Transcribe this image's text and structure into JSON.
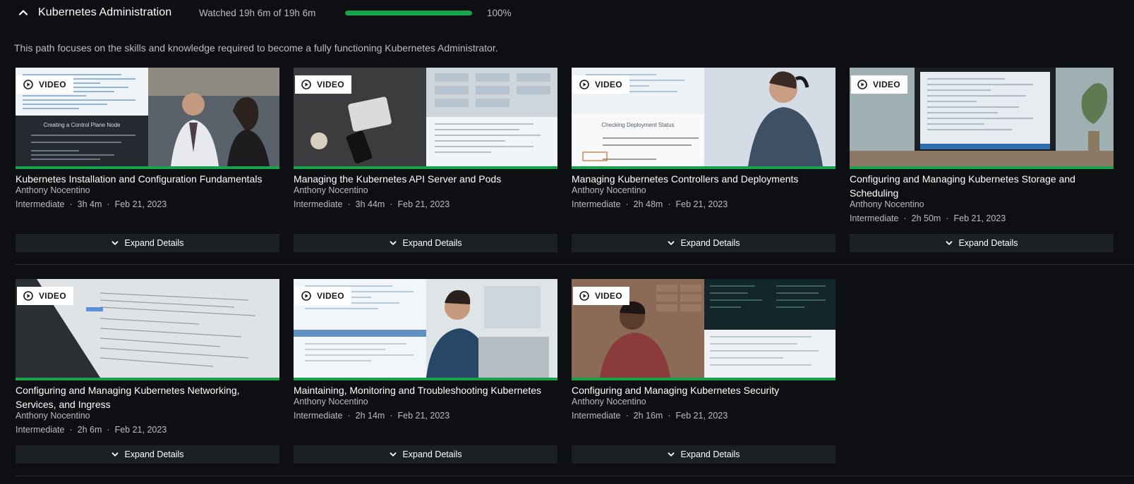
{
  "path": {
    "title": "Kubernetes Administration",
    "watched": "Watched 19h 6m of 19h 6m",
    "progress_fraction": 1.0,
    "progress_label": "100%",
    "description": "This path focuses on the skills and knowledge required to become a fully functioning Kubernetes Administrator.",
    "accent_color": "#17a34a"
  },
  "icons": {
    "collapse": "chevron-up-icon",
    "play": "play-circle-icon",
    "expand": "chevron-down-icon"
  },
  "courses": [
    {
      "badge": "VIDEO",
      "title": "Kubernetes Installation and Configuration Fundamentals",
      "author": "Anthony Nocentino",
      "level": "Intermediate",
      "duration": "3h 4m",
      "date": "Feb 21, 2023",
      "expand_label": "Expand Details",
      "thumb_text": "Creating a Control Plane Node"
    },
    {
      "badge": "VIDEO",
      "title": "Managing the Kubernetes API Server and Pods",
      "author": "Anthony Nocentino",
      "level": "Intermediate",
      "duration": "3h 44m",
      "date": "Feb 21, 2023",
      "expand_label": "Expand Details"
    },
    {
      "badge": "VIDEO",
      "title": "Managing Kubernetes Controllers and Deployments",
      "author": "Anthony Nocentino",
      "level": "Intermediate",
      "duration": "2h 48m",
      "date": "Feb 21, 2023",
      "expand_label": "Expand Details",
      "thumb_text": "Checking Deployment Status"
    },
    {
      "badge": "VIDEO",
      "title": "Configuring and Managing Kubernetes Storage and Scheduling",
      "author": "Anthony Nocentino",
      "level": "Intermediate",
      "duration": "2h 50m",
      "date": "Feb 21, 2023",
      "expand_label": "Expand Details"
    },
    {
      "badge": "VIDEO",
      "title": "Configuring and Managing Kubernetes Networking, Services, and Ingress",
      "author": "Anthony Nocentino",
      "level": "Intermediate",
      "duration": "2h 6m",
      "date": "Feb 21, 2023",
      "expand_label": "Expand Details"
    },
    {
      "badge": "VIDEO",
      "title": "Maintaining, Monitoring and Troubleshooting Kubernetes",
      "author": "Anthony Nocentino",
      "level": "Intermediate",
      "duration": "2h 14m",
      "date": "Feb 21, 2023",
      "expand_label": "Expand Details"
    },
    {
      "badge": "VIDEO",
      "title": "Configuring and Managing Kubernetes Security",
      "author": "Anthony Nocentino",
      "level": "Intermediate",
      "duration": "2h 16m",
      "date": "Feb 21, 2023",
      "expand_label": "Expand Details"
    }
  ]
}
